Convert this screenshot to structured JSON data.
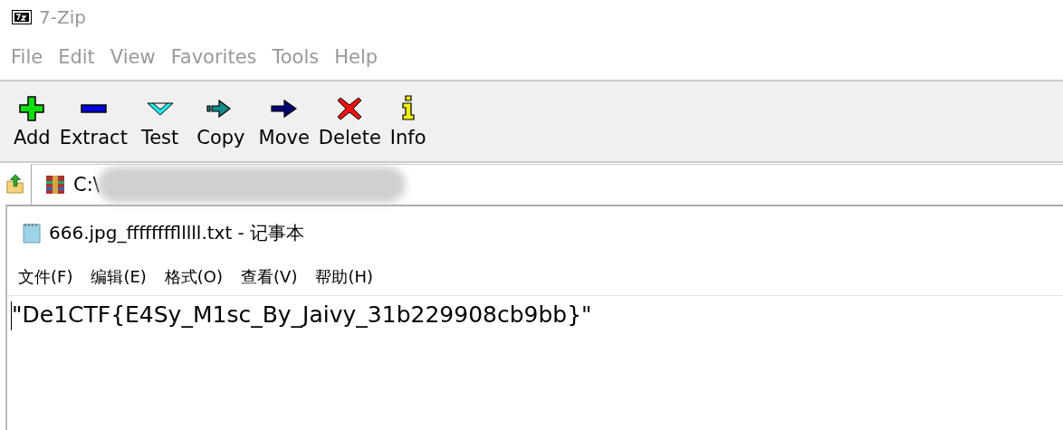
{
  "window": {
    "title": "7-Zip",
    "active": false
  },
  "menu": [
    "File",
    "Edit",
    "View",
    "Favorites",
    "Tools",
    "Help"
  ],
  "toolbar": [
    {
      "kind": "add",
      "label": "Add"
    },
    {
      "kind": "extract",
      "label": "Extract"
    },
    {
      "kind": "test",
      "label": "Test"
    },
    {
      "kind": "copy",
      "label": "Copy"
    },
    {
      "kind": "move",
      "label": "Move"
    },
    {
      "kind": "delete",
      "label": "Delete"
    },
    {
      "kind": "info",
      "label": "Info"
    }
  ],
  "address": {
    "value": "C:\\"
  },
  "notepad": {
    "title": "666.jpg_fffffffflllll.txt - 记事本",
    "menu": [
      "文件(F)",
      "编辑(E)",
      "格式(O)",
      "查看(V)",
      "帮助(H)"
    ],
    "content": "\"De1CTF{E4Sy_M1sc_By_Jaivy_31b229908cb9bb}\""
  }
}
